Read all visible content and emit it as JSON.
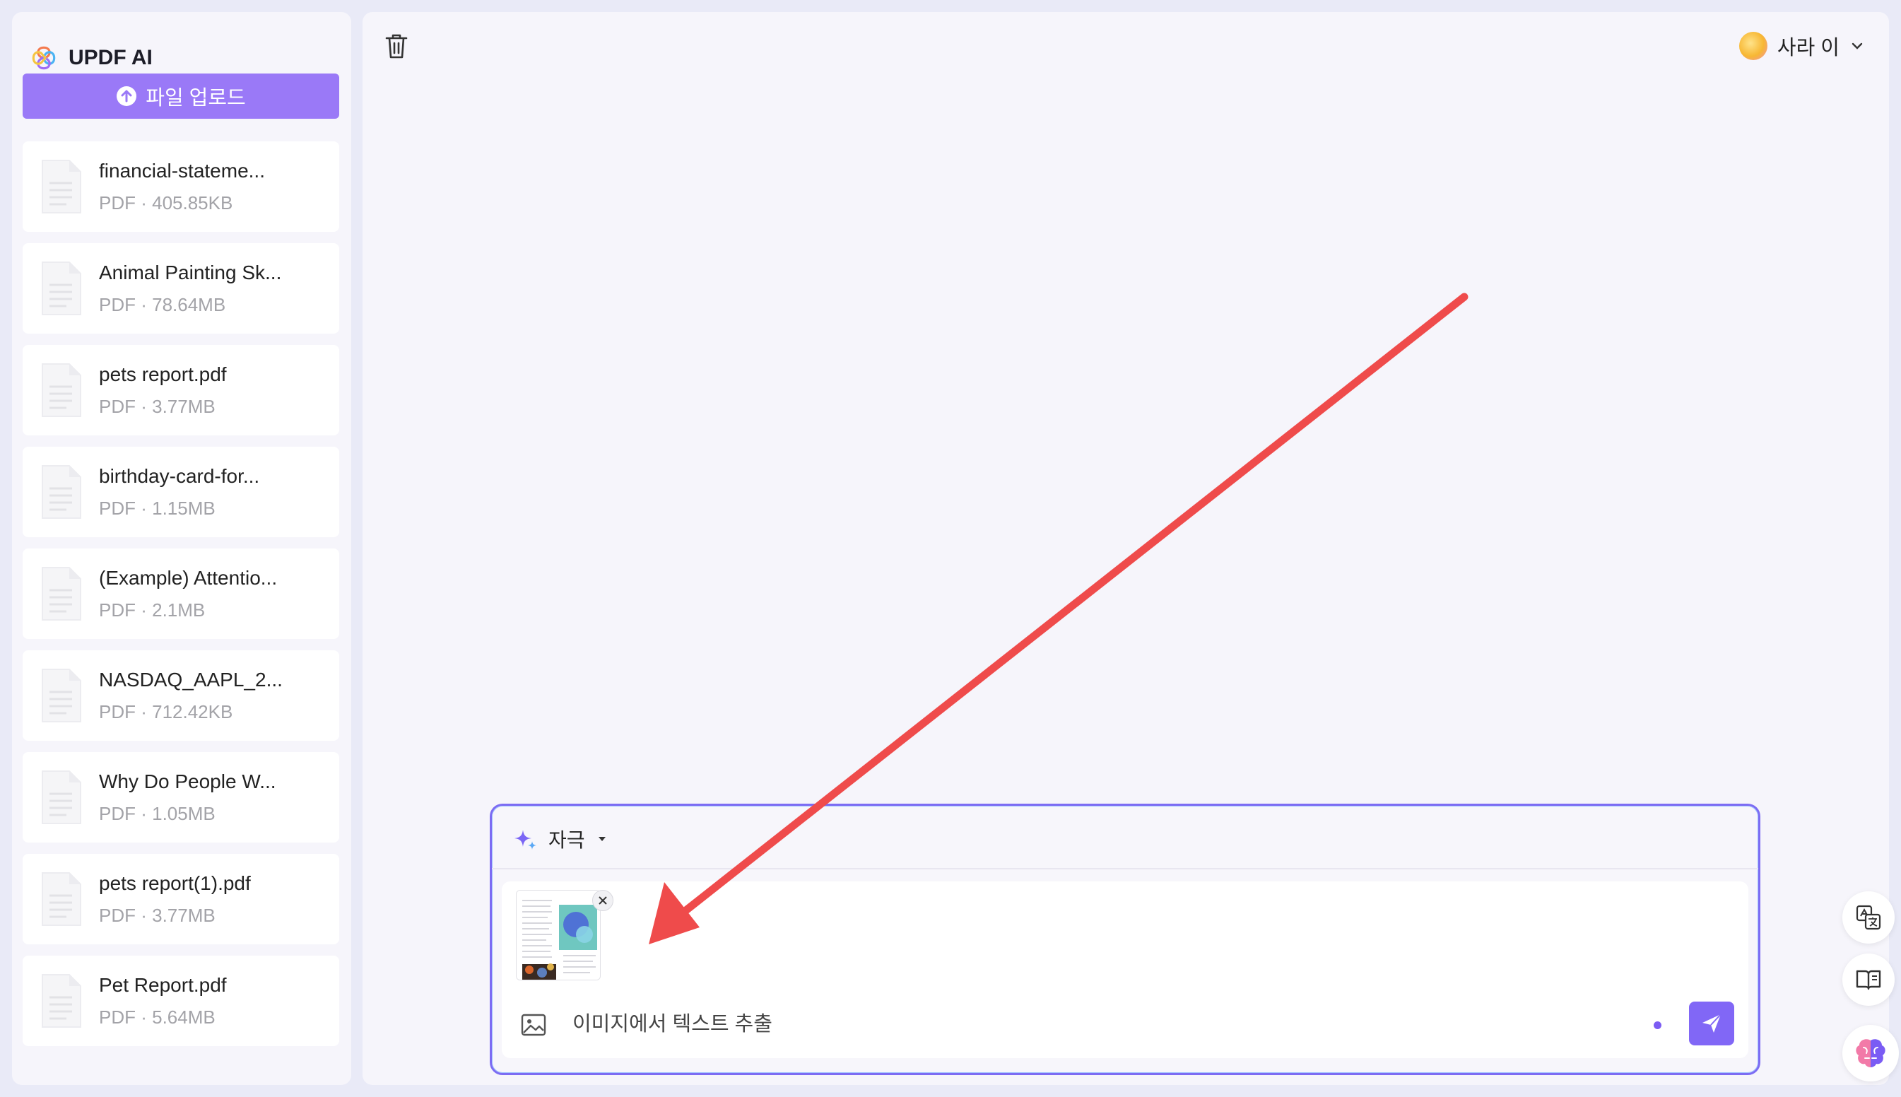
{
  "app": {
    "name": "UPDF AI"
  },
  "sidebar": {
    "upload_label": "파일 업로드",
    "files": [
      {
        "name": "financial-stateme...",
        "meta": "PDF · 405.85KB"
      },
      {
        "name": "Animal Painting Sk...",
        "meta": "PDF · 78.64MB"
      },
      {
        "name": "pets report.pdf",
        "meta": "PDF · 3.77MB"
      },
      {
        "name": "birthday-card-for...",
        "meta": "PDF · 1.15MB"
      },
      {
        "name": "(Example) Attentio...",
        "meta": "PDF · 2.1MB"
      },
      {
        "name": "NASDAQ_AAPL_2...",
        "meta": "PDF · 712.42KB"
      },
      {
        "name": "Why Do People W...",
        "meta": "PDF · 1.05MB"
      },
      {
        "name": "pets report(1).pdf",
        "meta": "PDF · 3.77MB"
      },
      {
        "name": "Pet Report.pdf",
        "meta": "PDF · 5.64MB"
      }
    ]
  },
  "header": {
    "user_name": "사라 이"
  },
  "chat": {
    "prompt_label": "자극",
    "input_value": "이미지에서 텍스트 추출"
  },
  "icons": {
    "trash": "trash-icon",
    "upload": "upload-icon",
    "sparkle": "sparkle-icon",
    "image": "image-icon",
    "send": "send-icon",
    "translate": "translate-icon",
    "book": "book-icon",
    "brain": "brain-icon"
  },
  "colors": {
    "accent": "#9a79f7",
    "send": "#8167f6",
    "border": "#7c6cf3",
    "arrow": "#ef4b4b"
  }
}
